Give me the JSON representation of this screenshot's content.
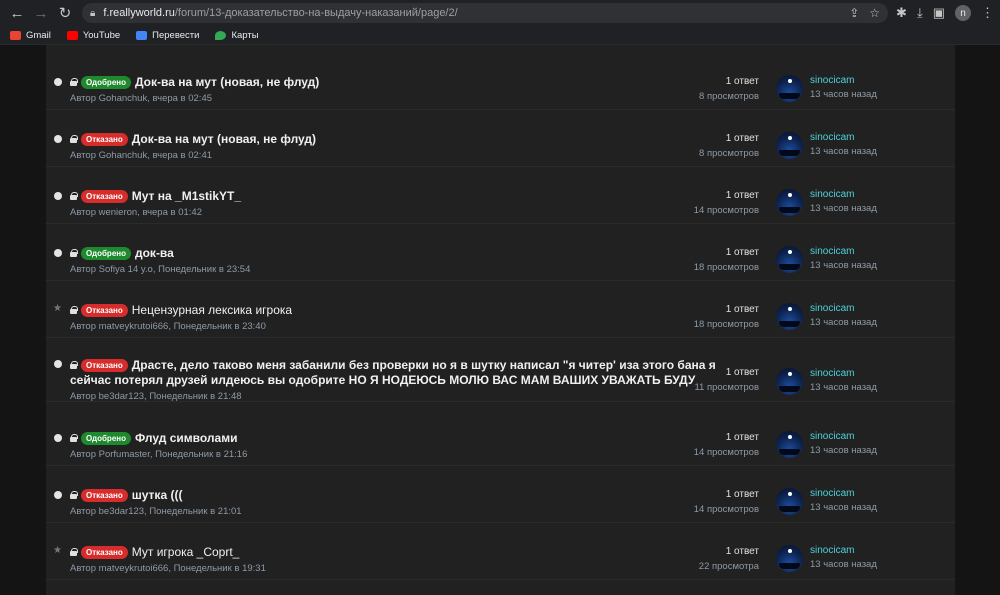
{
  "browser": {
    "url_host": "f.reallyworld.ru",
    "url_path": "/forum/13-доказательство-на-выдачу-наказаний/page/2/",
    "profile_initial": "n",
    "bookmarks": [
      {
        "label": "Gmail",
        "icon": "gmail-icon",
        "color": "#ea4335"
      },
      {
        "label": "YouTube",
        "icon": "youtube-icon",
        "color": "#ff0000"
      },
      {
        "label": "Перевести",
        "icon": "translate-icon",
        "color": "#4285f4"
      },
      {
        "label": "Карты",
        "icon": "maps-icon",
        "color": "#34a853"
      }
    ]
  },
  "topics": [
    {
      "prefix": "Одобрено",
      "status": "approved",
      "title": "Док-ва на мут (новая, не флуд)",
      "bold": true,
      "meta": "Автор Gohanchuk, вчера в 02:45",
      "answers": "1 ответ",
      "views": "8 просмотров",
      "last_user": "sinocicam",
      "last_time": "13 часов назад"
    },
    {
      "prefix": "Отказано",
      "status": "rejected",
      "title": "Док-ва на мут (новая, не флуд)",
      "bold": true,
      "meta": "Автор Gohanchuk, вчера в 02:41",
      "answers": "1 ответ",
      "views": "8 просмотров",
      "last_user": "sinocicam",
      "last_time": "13 часов назад"
    },
    {
      "prefix": "Отказано",
      "status": "rejected",
      "title": "Мут на _M1stikYT_",
      "bold": true,
      "meta": "Автор wenieron, вчера в 01:42",
      "answers": "1 ответ",
      "views": "14 просмотров",
      "last_user": "sinocicam",
      "last_time": "13 часов назад"
    },
    {
      "prefix": "Одобрено",
      "status": "approved",
      "title": "док-ва",
      "bold": true,
      "meta": "Автор Sofiya 14 y.o, Понедельник в 23:54",
      "answers": "1 ответ",
      "views": "18 просмотров",
      "last_user": "sinocicam",
      "last_time": "13 часов назад"
    },
    {
      "prefix": "Отказано",
      "status": "rejected",
      "title": "Нецензурная лексика игрока",
      "bold": false,
      "meta": "Автор matveykrutoi666, Понедельник в 23:40",
      "answers": "1 ответ",
      "views": "18 просмотров",
      "last_user": "sinocicam",
      "last_time": "13 часов назад"
    },
    {
      "prefix": "Отказано",
      "status": "rejected",
      "title": "Драсте, дело таково меня забанили без проверки но я в шутку написал \"я читер' иза этого бана я",
      "title_line2": "сейчас потерял друзей илдеюсь вы одобрите НО Я НОДЕЮСЬ МОЛЮ ВАС МАМ ВАШИХ УВАЖАТЬ БУДУ",
      "bold": true,
      "meta": "Автор be3dar123, Понедельник в 21:48",
      "answers": "1 ответ",
      "views": "11 просмотров",
      "last_user": "sinocicam",
      "last_time": "13 часов назад"
    },
    {
      "prefix": "Одобрено",
      "status": "approved",
      "title": "Флуд символами",
      "bold": true,
      "meta": "Автор Porfumaster, Понедельник в 21:16",
      "answers": "1 ответ",
      "views": "14 просмотров",
      "last_user": "sinocicam",
      "last_time": "13 часов назад"
    },
    {
      "prefix": "Отказано",
      "status": "rejected",
      "title": "шутка (((",
      "bold": true,
      "meta": "Автор be3dar123, Понедельник в 21:01",
      "answers": "1 ответ",
      "views": "14 просмотров",
      "last_user": "sinocicam",
      "last_time": "13 часов назад"
    },
    {
      "prefix": "Отказано",
      "status": "rejected",
      "title": "Мут игрока _Coprt_",
      "bold": false,
      "meta": "Автор matveykrutoi666, Понедельник в 19:31",
      "answers": "1 ответ",
      "views": "22 просмотра",
      "last_user": "sinocicam",
      "last_time": "13 часов назад"
    }
  ]
}
